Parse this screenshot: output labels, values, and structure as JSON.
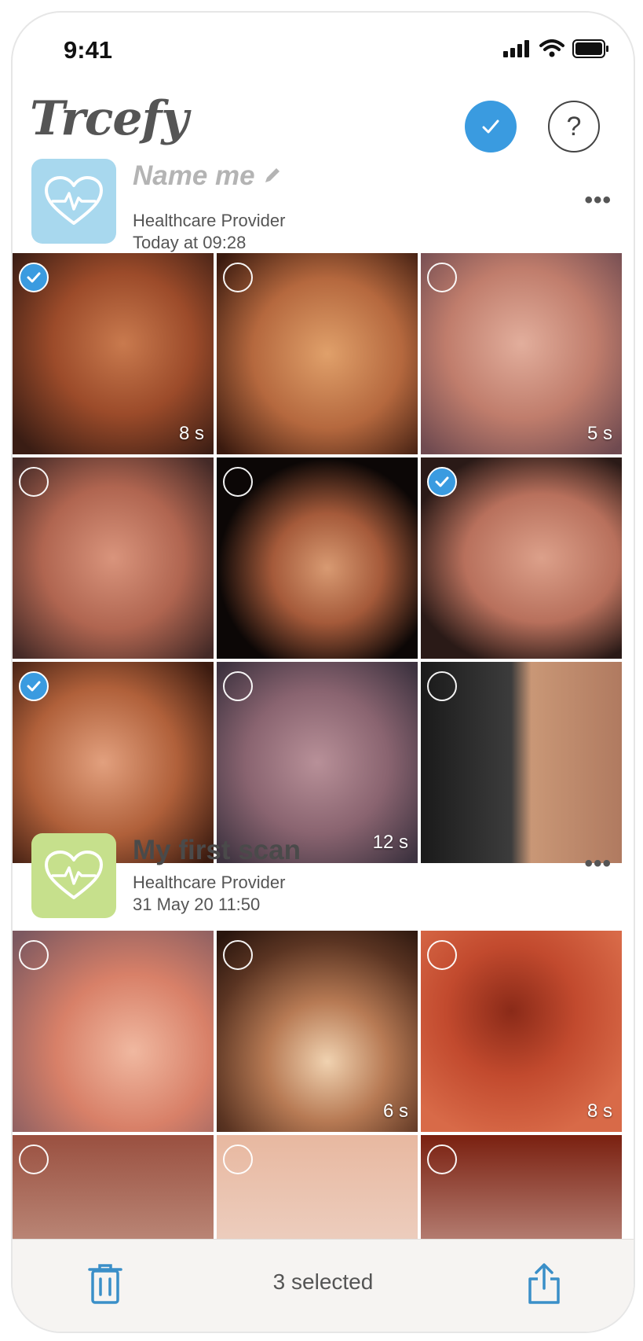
{
  "status": {
    "time": "9:41"
  },
  "app": {
    "logo": "Trcefy"
  },
  "header": {
    "select_icon": "check-icon",
    "help_icon": "?"
  },
  "scans": [
    {
      "title": "Name me",
      "provider": "Healthcare Provider",
      "date": "Today at 09:28",
      "tile_color": "#a8d8ee",
      "title_color": "#b4b4b4",
      "more": "•••",
      "items": [
        {
          "selected": true,
          "duration": "8 s",
          "bg": "radial-gradient(circle at 55% 45%, #c97a4e 0%, #9c4b2a 45%, #3a1d14 90%)"
        },
        {
          "selected": false,
          "duration": "",
          "bg": "radial-gradient(circle at 55% 50%, #e0a06a 0%, #b5683e 50%, #3a1a0f 95%)"
        },
        {
          "selected": false,
          "duration": "5 s",
          "bg": "radial-gradient(circle at 50% 45%, #e2ae9c 0%, #c07d6c 50%, #6f4a50 95%)"
        },
        {
          "selected": false,
          "duration": "",
          "bg": "radial-gradient(circle at 50% 50%, #d9947c 0%, #b06550 50%, #442a27 95%)"
        },
        {
          "selected": false,
          "duration": "",
          "bg": "radial-gradient(ellipse at 55% 55%, #d89a72 0%, #a55a3a 35%, #0c0706 70%)"
        },
        {
          "selected": true,
          "duration": "",
          "bg": "radial-gradient(ellipse at 60% 50%, #dca08a 0%, #b8705c 45%, #2a1a17 80%)"
        },
        {
          "selected": true,
          "duration": "",
          "bg": "radial-gradient(circle at 45% 50%, #e2a07e 0%, #b0603a 50%, #3b1b10 95%)"
        },
        {
          "selected": false,
          "duration": "12 s",
          "bg": "radial-gradient(circle at 50% 50%, #b89098 0%, #8a6470 50%, #3e3340 95%)"
        },
        {
          "selected": false,
          "duration": "",
          "bg": "linear-gradient(90deg, #1a1a1a 0%, #3c3c3c 45%, #c99776 55%, #b07a60 100%)"
        }
      ]
    },
    {
      "title": "My first scan",
      "provider": "Healthcare Provider",
      "date": "31 May 20 11:50",
      "tile_color": "#c6e08c",
      "title_color": "#4a4a4a",
      "more": "•••",
      "items": [
        {
          "selected": false,
          "duration": "",
          "bg": "radial-gradient(circle at 60% 60%, #f0b8a0 0%, #d88068 45%, #7c5860 95%)"
        },
        {
          "selected": false,
          "duration": "6 s",
          "bg": "radial-gradient(circle at 55% 65%, #f0d2b0 0%, #b77a54 35%, #5a3422 70%, #2a160e 95%)"
        },
        {
          "selected": false,
          "duration": "8 s",
          "bg": "radial-gradient(circle at 45% 40%, #8a2a18 0%, #c24a2e 40%, #d86a48 80%)"
        }
      ]
    }
  ],
  "partial_row": [
    {
      "bg": "linear-gradient(180deg, #9a5040 0%, #d6b6a6 100%)"
    },
    {
      "bg": "linear-gradient(180deg, #e8b8a0 0%, #f0e0d8 100%)"
    },
    {
      "bg": "linear-gradient(180deg, #7a2010 0%, #e8d0c8 100%)"
    }
  ],
  "toolbar": {
    "selected_label": "3 selected",
    "delete_icon": "trash-icon",
    "share_icon": "share-icon"
  },
  "colors": {
    "accent": "#3a9be0",
    "icon_blue": "#3a8fc8"
  }
}
